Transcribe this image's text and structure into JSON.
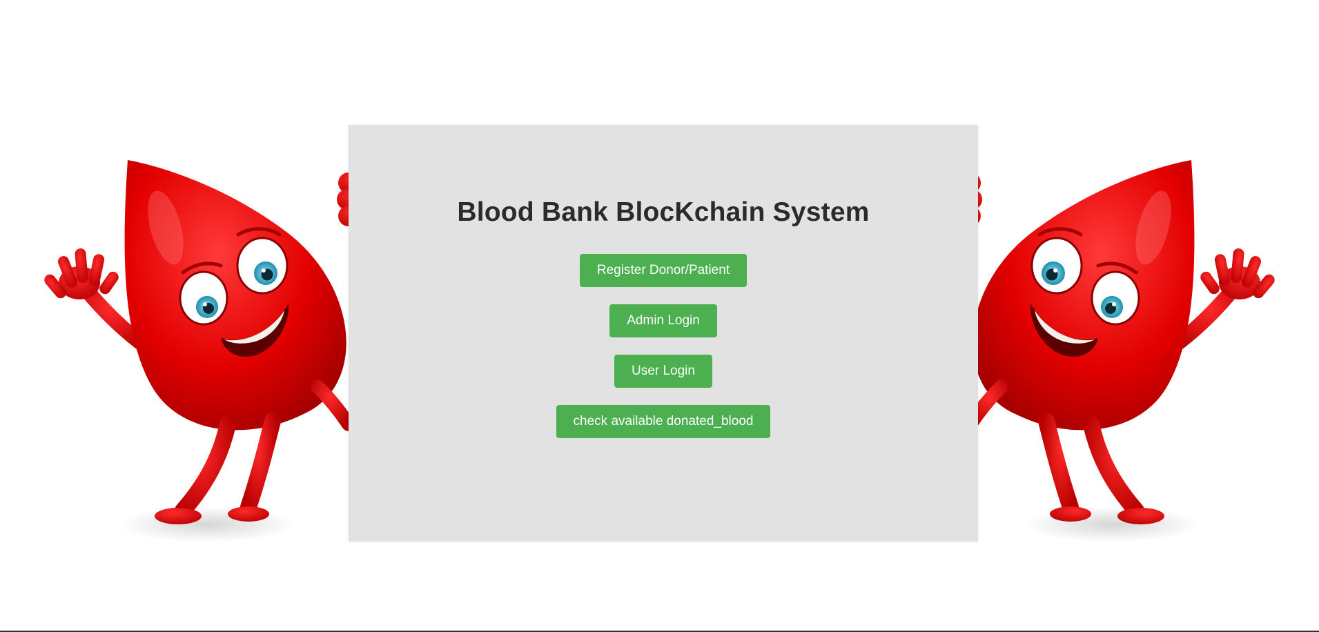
{
  "page": {
    "title": "Blood Bank BlocKchain System"
  },
  "buttons": {
    "register": "Register Donor/Patient",
    "admin_login": "Admin Login",
    "user_login": "User Login",
    "check_blood": "check available donated_blood"
  },
  "colors": {
    "button_bg": "#4caf50",
    "board_bg": "#e2e2e2",
    "mascot_red": "#e30000"
  },
  "icons": {
    "left_mascot": "blood-drop-mascot-icon",
    "right_mascot": "blood-drop-mascot-icon"
  }
}
